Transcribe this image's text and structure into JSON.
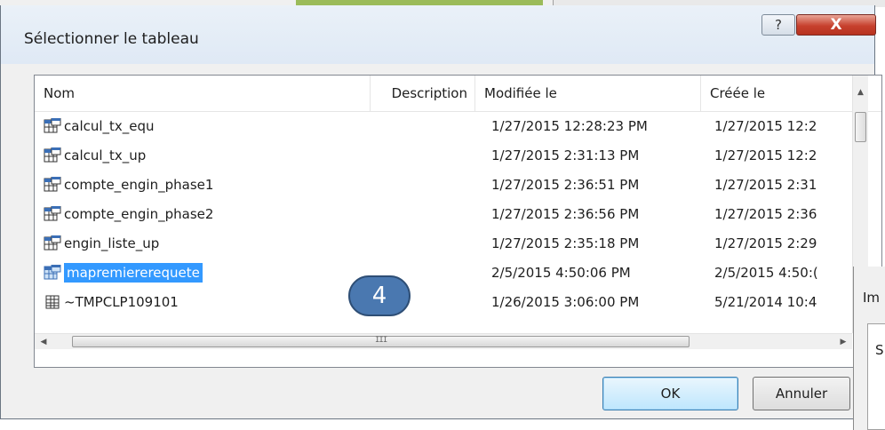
{
  "dialog": {
    "title": "Sélectionner le tableau",
    "help_label": "?",
    "close_label": "X"
  },
  "columns": {
    "name": "Nom",
    "description": "Description",
    "modified": "Modifiée le",
    "created": "Créée le"
  },
  "rows": [
    {
      "name": "calcul_tx_equ",
      "modified": "1/27/2015 12:28:23 PM",
      "created": "1/27/2015 12:2",
      "icon": "query-icon"
    },
    {
      "name": "calcul_tx_up",
      "modified": "1/27/2015 2:31:13 PM",
      "created": "1/27/2015 12:2",
      "icon": "query-icon"
    },
    {
      "name": "compte_engin_phase1",
      "modified": "1/27/2015 2:36:51 PM",
      "created": "1/27/2015 2:31",
      "icon": "query-icon"
    },
    {
      "name": "compte_engin_phase2",
      "modified": "1/27/2015 2:36:56 PM",
      "created": "1/27/2015 2:36",
      "icon": "query-icon"
    },
    {
      "name": "engin_liste_up",
      "modified": "1/27/2015 2:35:18 PM",
      "created": "1/27/2015 2:29",
      "icon": "query-icon"
    },
    {
      "name": "mapremiererequete",
      "modified": "2/5/2015 4:50:06 PM",
      "created": "2/5/2015 4:50:(",
      "icon": "query-icon",
      "selected": true
    },
    {
      "name": "~TMPCLP109101",
      "modified": "1/26/2015 3:06:00 PM",
      "created": "5/21/2014 10:4",
      "icon": "table-icon"
    }
  ],
  "scroll": {
    "grip": "III",
    "left_arrow": "◀",
    "right_arrow": "▶",
    "up_arrow": "▲"
  },
  "buttons": {
    "ok": "OK",
    "cancel": "Annuler"
  },
  "annotation": {
    "number": "4"
  },
  "background_dialog": {
    "title": "Im",
    "inner_label": "S"
  },
  "colors": {
    "selection": "#3399ff",
    "close_button": "#c7412e",
    "badge": "#4a78b0",
    "background_green": "#9bbb59"
  }
}
